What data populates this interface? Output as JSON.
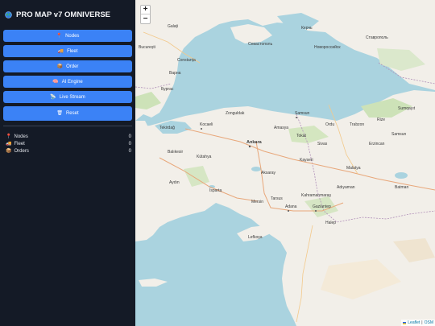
{
  "app": {
    "title": "PRO MAP v7 OMNIVERSE",
    "title_icon": "globe-icon"
  },
  "sidebar": {
    "buttons": [
      {
        "id": "nodes",
        "icon": "pin-icon",
        "glyph": "📍",
        "label": "Nodes"
      },
      {
        "id": "fleet",
        "icon": "truck-icon",
        "glyph": "🚚",
        "label": "Fleet"
      },
      {
        "id": "order",
        "icon": "package-icon",
        "glyph": "📦",
        "label": "Order"
      },
      {
        "id": "ai",
        "icon": "brain-icon",
        "glyph": "🧠",
        "label": "AI Engine"
      },
      {
        "id": "stream",
        "icon": "satellite-icon",
        "glyph": "📡",
        "label": "Live Stream"
      },
      {
        "id": "reset",
        "icon": "trash-icon",
        "glyph": "🗑",
        "label": "Reset"
      }
    ],
    "stats": [
      {
        "icon": "pin-icon",
        "glyph": "📍",
        "label": "Nodes",
        "value": "0"
      },
      {
        "icon": "truck-icon",
        "glyph": "🚚",
        "label": "Fleet",
        "value": "0"
      },
      {
        "icon": "package-icon",
        "glyph": "📦",
        "label": "Orders",
        "value": "0"
      }
    ]
  },
  "map": {
    "zoom_in": "+",
    "zoom_out": "−",
    "attribution": {
      "leaflet": "Leaflet",
      "separator": "|",
      "osm": "OSM"
    },
    "labels": {
      "galati": "Galați",
      "bucuresti": "București",
      "constanta": "Constanța",
      "varna": "Варна",
      "burgas": "Бургас",
      "sevastopol": "Севастополь",
      "novorossiysk": "Новороссийск",
      "stavropol": "Ставрополь",
      "kerch": "Керчь",
      "tekirdag": "Tekirdağ",
      "kocaeli": "Kocaeli",
      "zonguldak": "Zonguldak",
      "samsun": "Samsun",
      "ordu": "Ordu",
      "trabzon": "Trabzon",
      "rize": "Rize",
      "ankara": "Ankara",
      "balikesir": "Balıkesir",
      "aydin": "Aydın",
      "isparta": "Isparta",
      "aksaray": "Aksaray",
      "kayseri": "Kayseri",
      "malatya": "Malatya",
      "adiyaman": "Adıyaman",
      "batman": "Batman",
      "kahramanmaras": "Kahramanmaraş",
      "gaziantep": "Gaziantep",
      "adana": "Adana",
      "sivas": "Sivas",
      "erzincan": "Erzincan",
      "tokat": "Tokat",
      "amasya": "Amasya",
      "kutahya": "Kütahya",
      "tarsus": "Tarsus",
      "mersin": "Mersin",
      "halep": "Halep",
      "lefkosa": "Lefkoşa",
      "samsun2": "Samsun",
      "sumqayit": "Sumqayıt"
    }
  }
}
